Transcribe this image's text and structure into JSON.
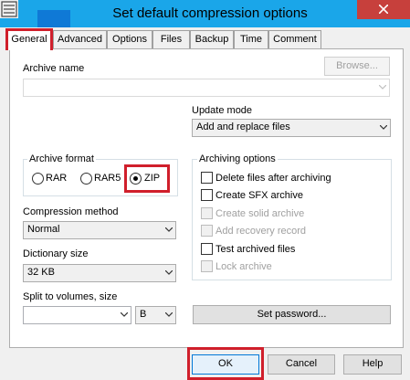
{
  "window": {
    "title": "Set default compression options"
  },
  "tabs": [
    {
      "label": "General"
    },
    {
      "label": "Advanced"
    },
    {
      "label": "Options"
    },
    {
      "label": "Files"
    },
    {
      "label": "Backup"
    },
    {
      "label": "Time"
    },
    {
      "label": "Comment"
    }
  ],
  "general": {
    "archive_name_label": "Archive name",
    "archive_name_value": "",
    "browse_label": "Browse...",
    "update_mode_label": "Update mode",
    "update_mode_value": "Add and replace files",
    "archive_format": {
      "label": "Archive format",
      "options": [
        {
          "label": "RAR",
          "selected": false
        },
        {
          "label": "RAR5",
          "selected": false
        },
        {
          "label": "ZIP",
          "selected": true
        }
      ]
    },
    "compression_method_label": "Compression method",
    "compression_method_value": "Normal",
    "dictionary_size_label": "Dictionary size",
    "dictionary_size_value": "32 KB",
    "split_label": "Split to volumes, size",
    "split_value": "",
    "split_unit": "B",
    "set_password_label": "Set password...",
    "archiving_options": {
      "label": "Archiving options",
      "items": [
        {
          "label": "Delete files after archiving",
          "checked": false,
          "enabled": true
        },
        {
          "label": "Create SFX archive",
          "checked": false,
          "enabled": true
        },
        {
          "label": "Create solid archive",
          "checked": false,
          "enabled": false
        },
        {
          "label": "Add recovery record",
          "checked": false,
          "enabled": false
        },
        {
          "label": "Test archived files",
          "checked": false,
          "enabled": true
        },
        {
          "label": "Lock archive",
          "checked": false,
          "enabled": false
        }
      ]
    }
  },
  "footer": {
    "ok_label": "OK",
    "cancel_label": "Cancel",
    "help_label": "Help"
  }
}
